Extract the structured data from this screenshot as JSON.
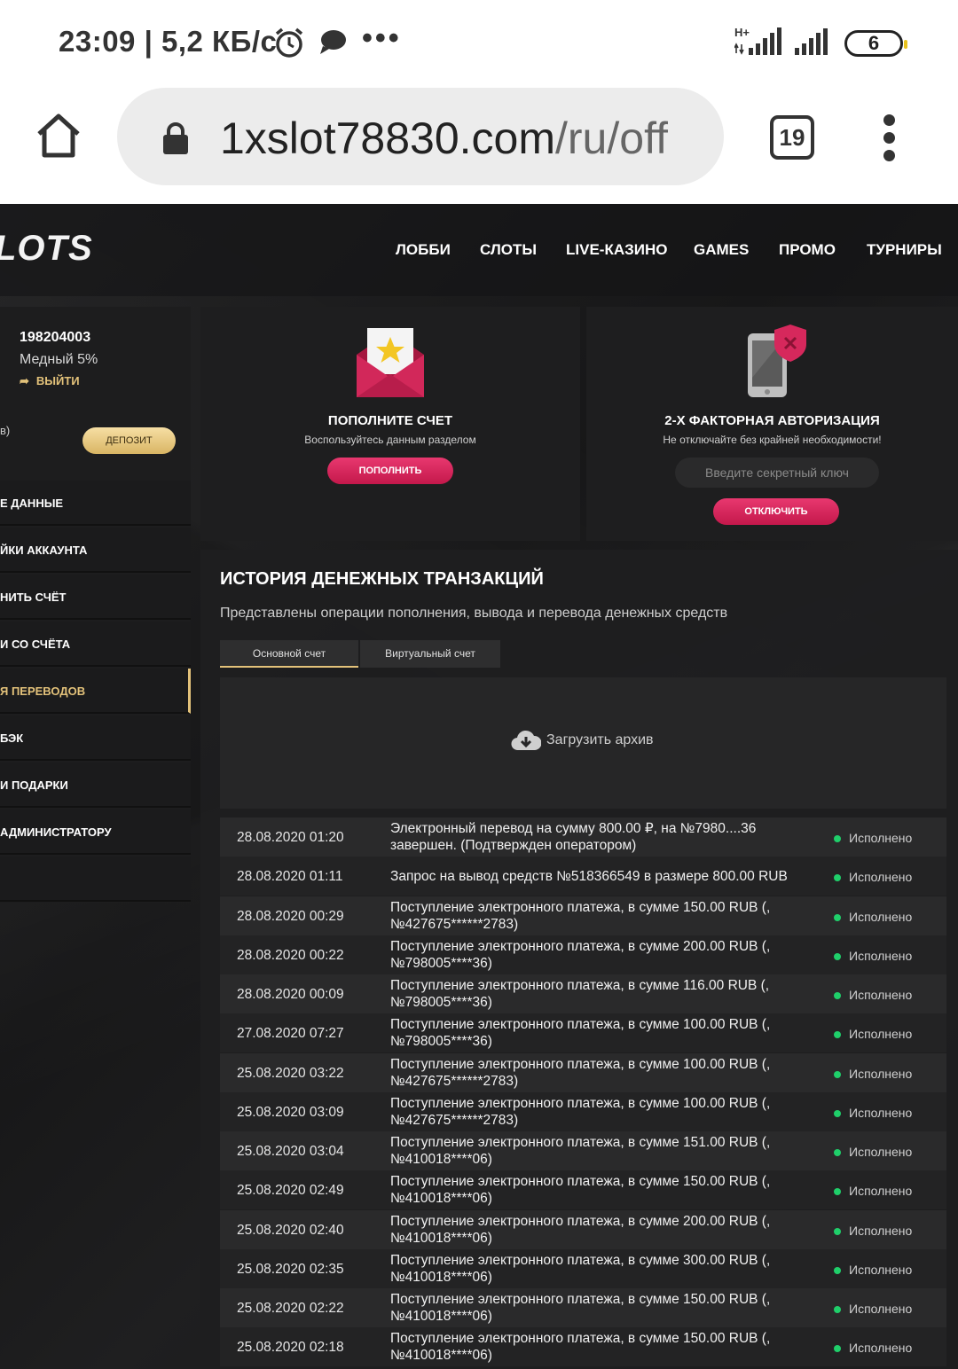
{
  "status_bar": {
    "time": "23:09 | 5,2 КБ/с",
    "network_type": "H+",
    "battery": "6",
    "more": "•••"
  },
  "browser": {
    "url_domain": "1xslot78830.com",
    "url_path": "/ru/off",
    "tab_count": "19"
  },
  "site": {
    "logo": "LOTS",
    "nav": [
      "ЛОББИ",
      "СЛОТЫ",
      "LIVE-КАЗИНО",
      "GAMES",
      "ПРОМО",
      "ТУРНИРЫ"
    ],
    "user": {
      "id": "198204003",
      "level": "Медный 5%",
      "logout": "ВЫЙТИ",
      "balance_fragment": "в)",
      "deposit_button": "ДЕПОЗИТ"
    },
    "menu": [
      "Е ДАННЫЕ",
      "ЙКИ АККАУНТА",
      "НИТЬ СЧЁТ",
      "И СО СЧЁТА",
      "Я ПЕРЕВОДОВ",
      "БЭК",
      "И ПОДАРКИ",
      " АДМИНИСТРАТОРУ",
      ""
    ],
    "deposit_card": {
      "title": "ПОПОЛНИТЕ СЧЕТ",
      "subtitle": "Воспользуйтесь данным разделом",
      "button": "ПОПОЛНИТЬ"
    },
    "twofa_card": {
      "title": "2-Х ФАКТОРНАЯ АВТОРИЗАЦИЯ",
      "subtitle": "Не отключайте без крайней необходимости!",
      "input_placeholder": "Введите секретный ключ",
      "button": "ОТКЛЮЧИТЬ"
    },
    "history": {
      "title": "ИСТОРИЯ ДЕНЕЖНЫХ ТРАНЗАКЦИЙ",
      "subtitle": "Представлены операции пополнения, вывода и перевода денежных средств",
      "tabs": [
        "Основной счет",
        "Виртуальный счет"
      ],
      "archive": "Загрузить архив",
      "rows": [
        {
          "date": "28.08.2020 01:20",
          "desc": "Электронный перевод на сумму 800.00 ₽, на №7980....36 завершен. (Подтвержден оператором)",
          "status": "Исполнено"
        },
        {
          "date": "28.08.2020 01:11",
          "desc": "Запрос на вывод средств №518366549 в размере 800.00 RUB",
          "status": "Исполнено"
        },
        {
          "date": "28.08.2020 00:29",
          "desc": "Поступление электронного платежа, в сумме 150.00 RUB (, №427675******2783)",
          "status": "Исполнено"
        },
        {
          "date": "28.08.2020 00:22",
          "desc": "Поступление электронного платежа, в сумме 200.00 RUB (, №798005****36)",
          "status": "Исполнено"
        },
        {
          "date": "28.08.2020 00:09",
          "desc": "Поступление электронного платежа, в сумме 116.00 RUB (, №798005****36)",
          "status": "Исполнено"
        },
        {
          "date": "27.08.2020 07:27",
          "desc": "Поступление электронного платежа, в сумме 100.00 RUB (, №798005****36)",
          "status": "Исполнено"
        },
        {
          "date": "25.08.2020 03:22",
          "desc": "Поступление электронного платежа, в сумме 100.00 RUB (, №427675******2783)",
          "status": "Исполнено"
        },
        {
          "date": "25.08.2020 03:09",
          "desc": "Поступление электронного платежа, в сумме 100.00 RUB (, №427675******2783)",
          "status": "Исполнено"
        },
        {
          "date": "25.08.2020 03:04",
          "desc": "Поступление электронного платежа, в сумме 151.00 RUB (, №410018****06)",
          "status": "Исполнено"
        },
        {
          "date": "25.08.2020 02:49",
          "desc": "Поступление электронного платежа, в сумме 150.00 RUB (, №410018****06)",
          "status": "Исполнено"
        },
        {
          "date": "25.08.2020 02:40",
          "desc": "Поступление электронного платежа, в сумме 200.00 RUB (, №410018****06)",
          "status": "Исполнено"
        },
        {
          "date": "25.08.2020 02:35",
          "desc": "Поступление электронного платежа, в сумме 300.00 RUB (, №410018****06)",
          "status": "Исполнено"
        },
        {
          "date": "25.08.2020 02:22",
          "desc": "Поступление электронного платежа, в сумме 150.00 RUB (, №410018****06)",
          "status": "Исполнено"
        },
        {
          "date": "25.08.2020 02:18",
          "desc": "Поступление электронного платежа, в сумме 150.00 RUB (, №410018****06)",
          "status": "Исполнено"
        }
      ]
    },
    "colors": {
      "accent_gold": "#e3c27a",
      "button_pink": "#d6285c",
      "status_green": "#1fcf6a"
    }
  }
}
